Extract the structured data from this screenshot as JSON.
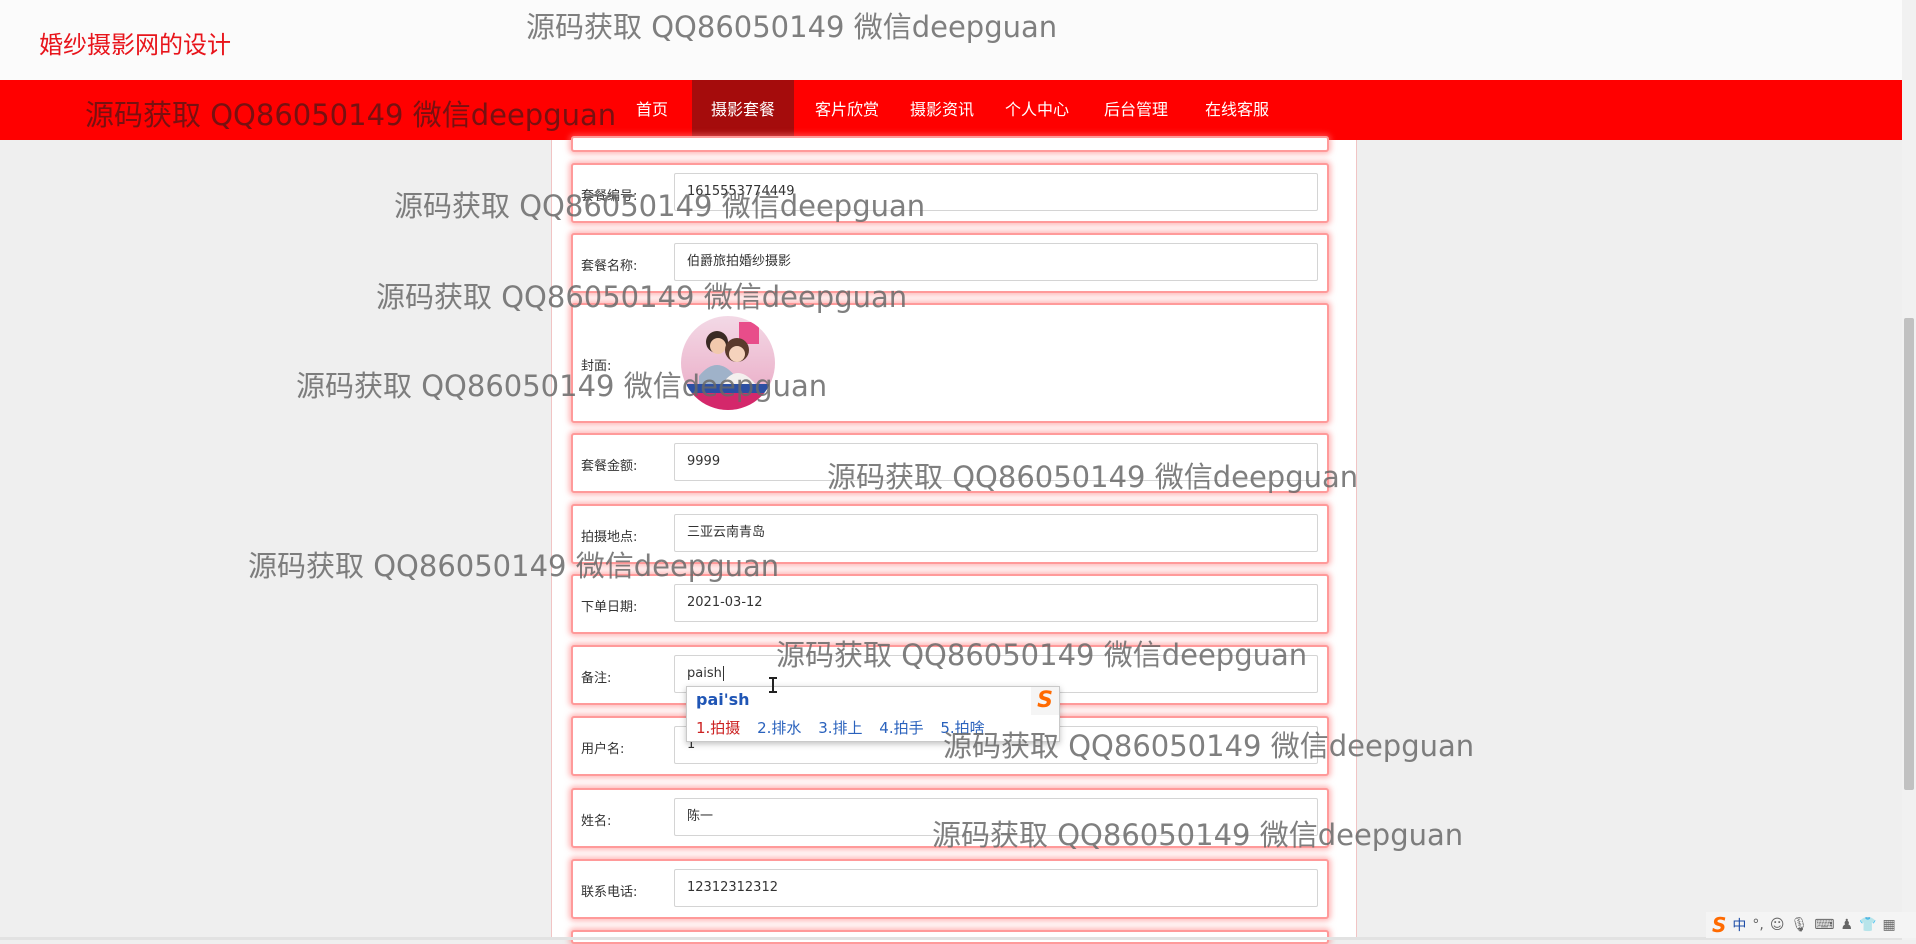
{
  "site": {
    "title": "婚纱摄影网的设计"
  },
  "nav": {
    "items": [
      {
        "label": "首页"
      },
      {
        "label": "摄影套餐",
        "active": true
      },
      {
        "label": "客片欣赏"
      },
      {
        "label": "摄影资讯"
      },
      {
        "label": "个人中心"
      },
      {
        "label": "后台管理"
      },
      {
        "label": "在线客服"
      }
    ]
  },
  "form": {
    "package_no": {
      "label": "套餐编号:",
      "value": "1615553774449"
    },
    "package_name": {
      "label": "套餐名称:",
      "value": "伯爵旅拍婚纱摄影"
    },
    "cover": {
      "label": "封面:"
    },
    "amount": {
      "label": "套餐金额:",
      "value": "9999"
    },
    "location": {
      "label": "拍摄地点:",
      "value": "三亚云南青岛"
    },
    "order_date": {
      "label": "下单日期:",
      "value": "2021-03-12"
    },
    "remark": {
      "label": "备注:",
      "value": "paish"
    },
    "username": {
      "label": "用户名:",
      "value": "1"
    },
    "name": {
      "label": "姓名:",
      "value": "陈一"
    },
    "phone": {
      "label": "联系电话:",
      "value": "12312312312"
    }
  },
  "ime": {
    "pinyin": "pai'sh",
    "candidates": [
      "1.拍摄",
      "2.排水",
      "3.排上",
      "4.拍手",
      "5.拍啥"
    ],
    "logo": "S"
  },
  "watermark": {
    "text": "源码获取 QQ86050149 微信deepguan"
  },
  "tray": {
    "logo": "S",
    "lang": "中",
    "icons": [
      "punctuation-icon",
      "emoji-icon",
      "mic-icon",
      "keyboard-icon",
      "user-icon",
      "skin-icon",
      "grid-icon"
    ]
  },
  "colors": {
    "brand_red": "#ff0000",
    "active_nav": "#a50c0c",
    "title_red": "#e8141b"
  }
}
